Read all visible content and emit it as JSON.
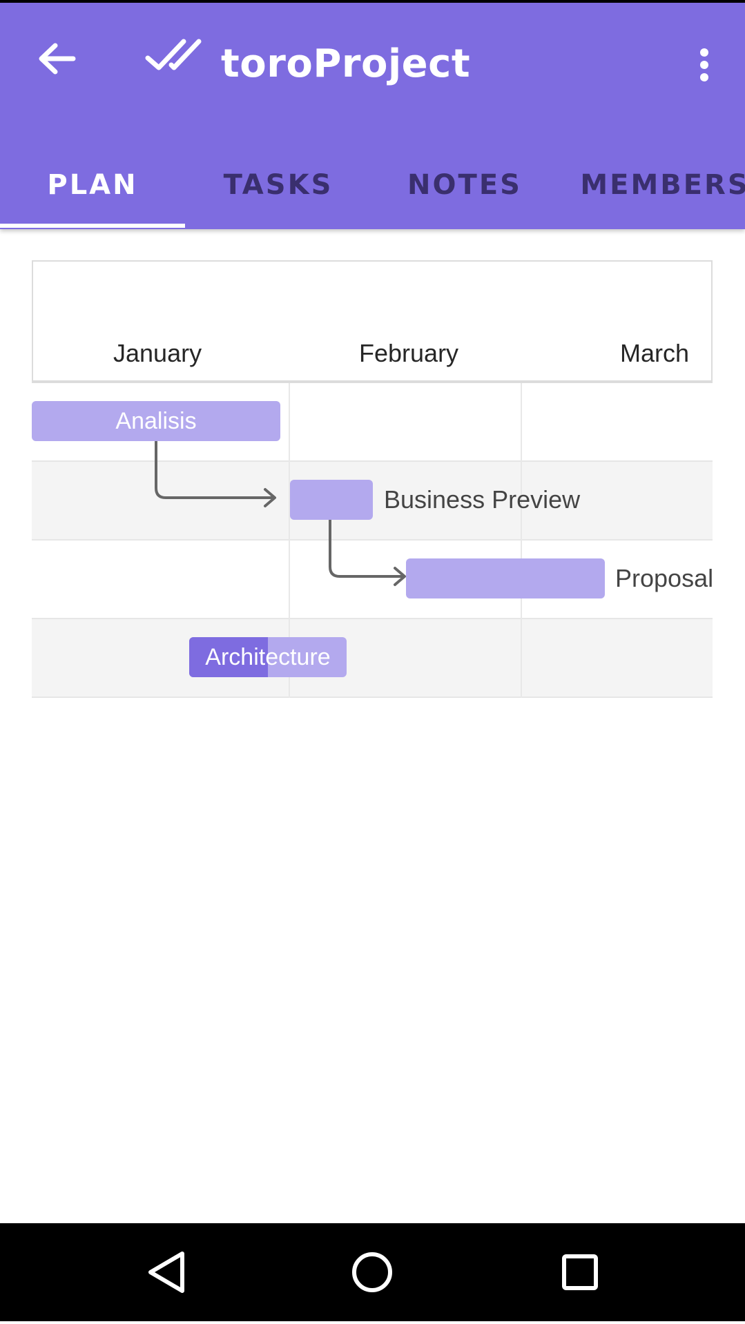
{
  "appbar": {
    "title": "toroProject",
    "back_icon": "arrow-back-icon",
    "logo_icon": "double-check-icon",
    "overflow_icon": "more-vert-icon",
    "color": "#7e6ce0"
  },
  "tabs": [
    {
      "label": "PLAN",
      "active": true
    },
    {
      "label": "TASKS",
      "active": false
    },
    {
      "label": "NOTES",
      "active": false
    },
    {
      "label": "MEMBERS",
      "active": false
    }
  ],
  "gantt": {
    "months": [
      "January",
      "February",
      "March"
    ],
    "tasks": [
      {
        "name": "Analisis",
        "label_position": "inside",
        "progress": 0
      },
      {
        "name": "Business Preview",
        "label_position": "outside",
        "progress": 0
      },
      {
        "name": "Proposal",
        "label_position": "outside",
        "progress": 0
      },
      {
        "name": "Architecture",
        "label_position": "inside",
        "progress": 0.5
      }
    ],
    "dependencies": [
      {
        "from": "Analisis",
        "to": "Business Preview"
      },
      {
        "from": "Business Preview",
        "to": "Proposal"
      }
    ],
    "bar_color": "#b3a9ee",
    "progress_color": "#7e6ce0"
  },
  "navbar": {
    "back_icon": "nav-back-triangle-icon",
    "home_icon": "nav-home-circle-icon",
    "recents_icon": "nav-recents-square-icon"
  }
}
